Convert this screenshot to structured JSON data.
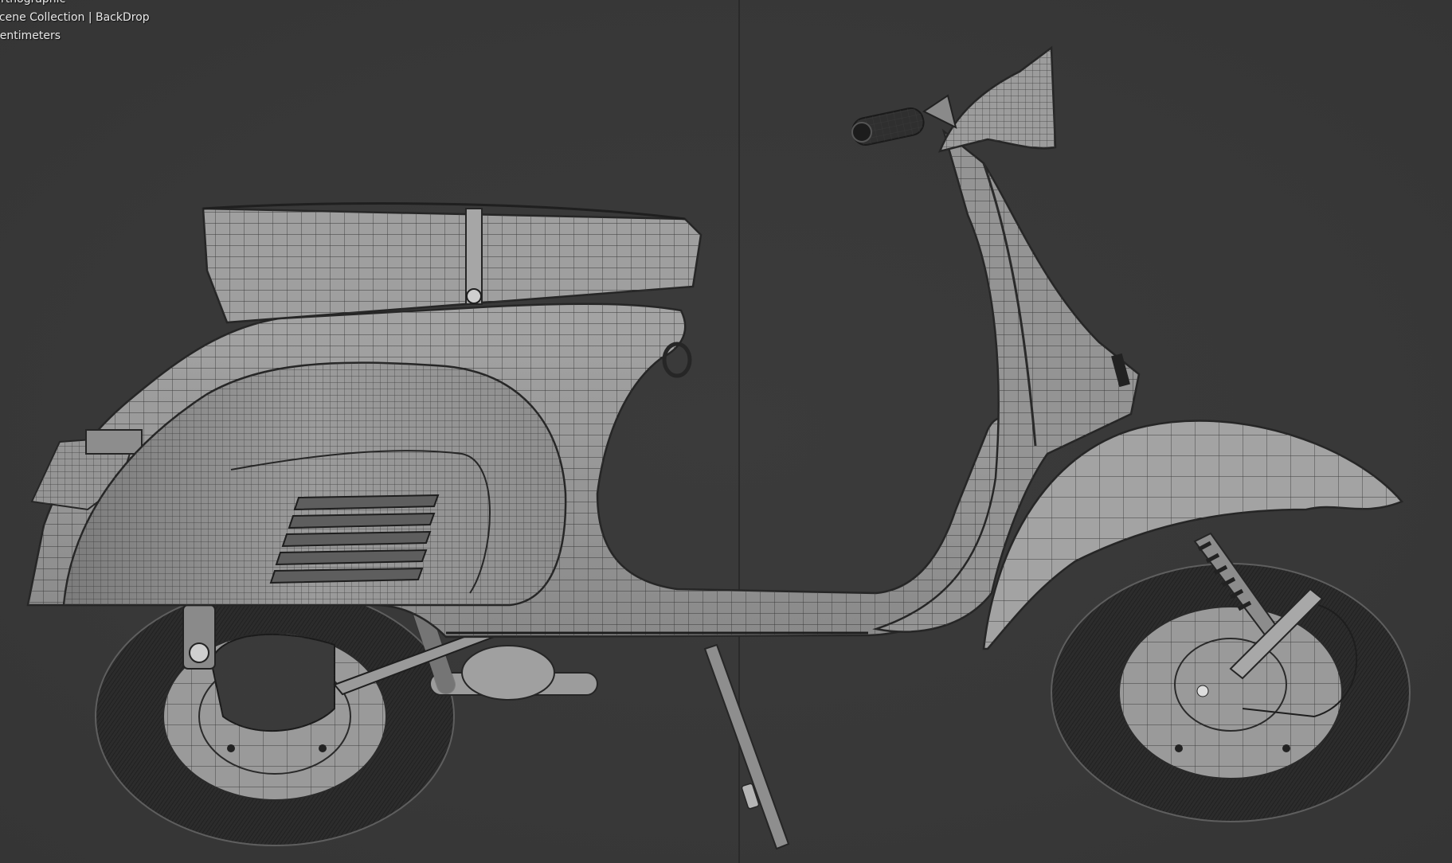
{
  "viewport": {
    "overlay": {
      "view_name": "Orthographic",
      "collection": "Scene Collection | BackDrop",
      "units": "Centimeters"
    },
    "colors": {
      "background": "#393939",
      "model_fill": "#8f8f8f",
      "wire": "#2b2b2b",
      "text": "#e8e8e8"
    },
    "model": {
      "name": "scooter",
      "view": "side",
      "shading": "solid-wireframe"
    }
  }
}
